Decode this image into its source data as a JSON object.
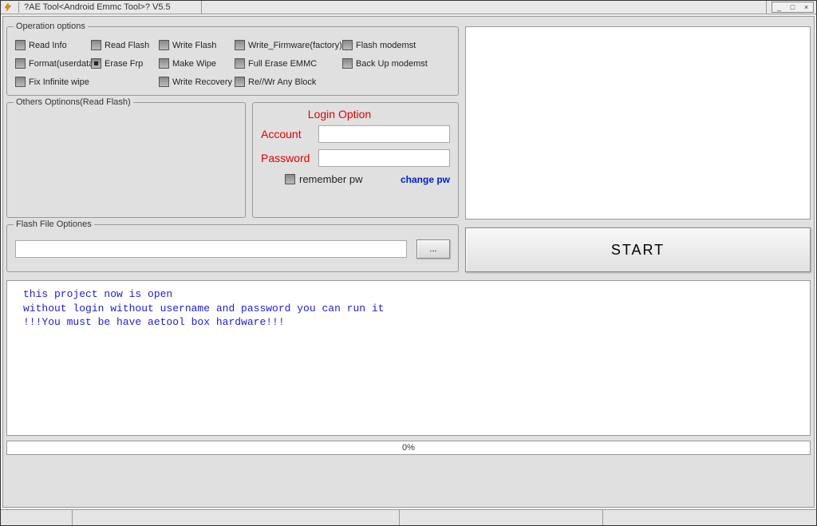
{
  "window": {
    "title": "?AE Tool<Android Emmc Tool>? V5.5"
  },
  "operation": {
    "legend": "Operation options",
    "items": [
      "Read Info",
      "Read Flash",
      "Write Flash",
      "Write_Firmware(factory)",
      "Flash modemst",
      "Format(userdata)",
      "Erase Frp",
      "Make Wipe",
      "Full Erase EMMC",
      "Back Up modemst",
      "Fix Infinite wipe",
      "",
      "Write Recovery",
      "Re//Wr Any Block",
      ""
    ]
  },
  "others": {
    "legend": "Others Optinons(Read Flash)"
  },
  "login": {
    "title": "Login Option",
    "account_label": "Account",
    "password_label": "Password",
    "account_value": "",
    "password_value": "",
    "remember_label": "remember pw",
    "change_pw_label": "change pw"
  },
  "flash": {
    "legend": "Flash File Optiones",
    "path_value": "",
    "browse_label": "..."
  },
  "start_label": "START",
  "log": {
    "line1": "this project now is open",
    "line2": "without login without username and password you can run it",
    "line3": "!!!You must be have aetool box hardware!!!"
  },
  "progress_text": "0%"
}
